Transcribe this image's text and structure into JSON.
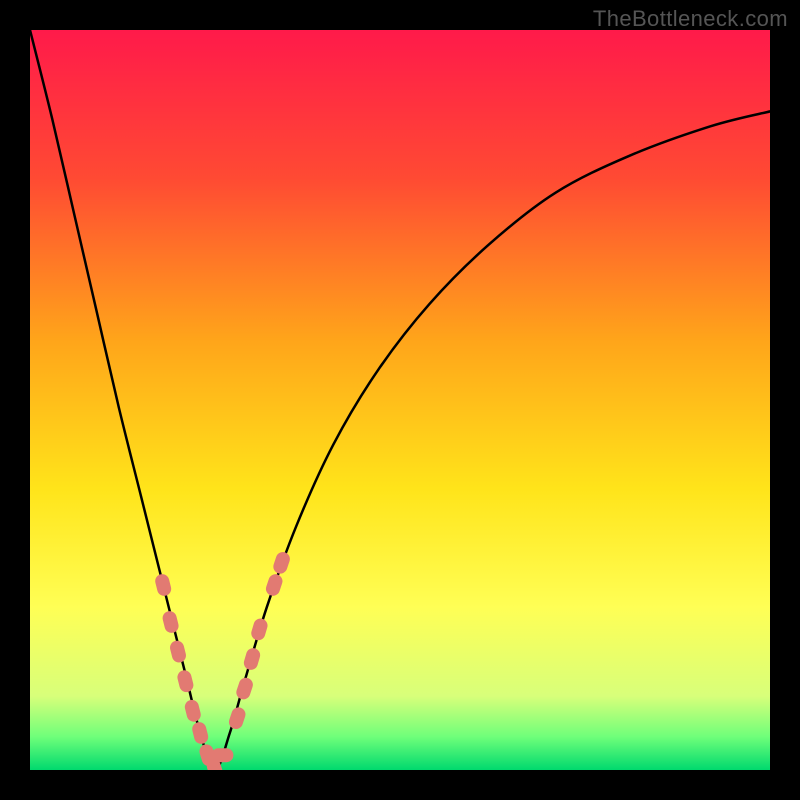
{
  "watermark": "TheBottleneck.com",
  "chart_data": {
    "type": "line",
    "title": "",
    "xlabel": "",
    "ylabel": "",
    "xlim": [
      0,
      100
    ],
    "ylim": [
      0,
      100
    ],
    "background": {
      "gradient": "vertical",
      "stops": [
        {
          "pos": 0.0,
          "color": "#ff1a4a"
        },
        {
          "pos": 0.2,
          "color": "#ff4a33"
        },
        {
          "pos": 0.42,
          "color": "#ffa51a"
        },
        {
          "pos": 0.62,
          "color": "#ffe41a"
        },
        {
          "pos": 0.78,
          "color": "#ffff55"
        },
        {
          "pos": 0.9,
          "color": "#d8ff7a"
        },
        {
          "pos": 0.955,
          "color": "#6fff7a"
        },
        {
          "pos": 1.0,
          "color": "#00d96e"
        }
      ],
      "note": "Heat gradient background: red (top/poor) → green (bottom/optimal)"
    },
    "series": [
      {
        "name": "bottleneck-curve",
        "note": "V-shaped bottleneck indicator; minimum near x≈25, y≈0 (optimal match)",
        "x": [
          0,
          3,
          6,
          9,
          12,
          15,
          18,
          21,
          23,
          25,
          27,
          29,
          32,
          36,
          41,
          47,
          54,
          62,
          71,
          81,
          92,
          100
        ],
        "y": [
          100,
          88,
          75,
          62,
          49,
          37,
          25,
          13,
          5,
          0,
          5,
          12,
          22,
          33,
          44,
          54,
          63,
          71,
          78,
          83,
          87,
          89
        ],
        "stroke": "#000000",
        "stroke_width": 2.5
      },
      {
        "name": "highlight-markers",
        "note": "Salmon pill markers along the lower region of the curve",
        "marker_color": "#e27a72",
        "points": [
          {
            "x": 18,
            "y": 25
          },
          {
            "x": 19,
            "y": 20
          },
          {
            "x": 20,
            "y": 16
          },
          {
            "x": 21,
            "y": 12
          },
          {
            "x": 22,
            "y": 8
          },
          {
            "x": 23,
            "y": 5
          },
          {
            "x": 24,
            "y": 2
          },
          {
            "x": 25,
            "y": 0
          },
          {
            "x": 26,
            "y": 2
          },
          {
            "x": 28,
            "y": 7
          },
          {
            "x": 29,
            "y": 11
          },
          {
            "x": 30,
            "y": 15
          },
          {
            "x": 31,
            "y": 19
          },
          {
            "x": 33,
            "y": 25
          },
          {
            "x": 34,
            "y": 28
          }
        ]
      }
    ]
  }
}
